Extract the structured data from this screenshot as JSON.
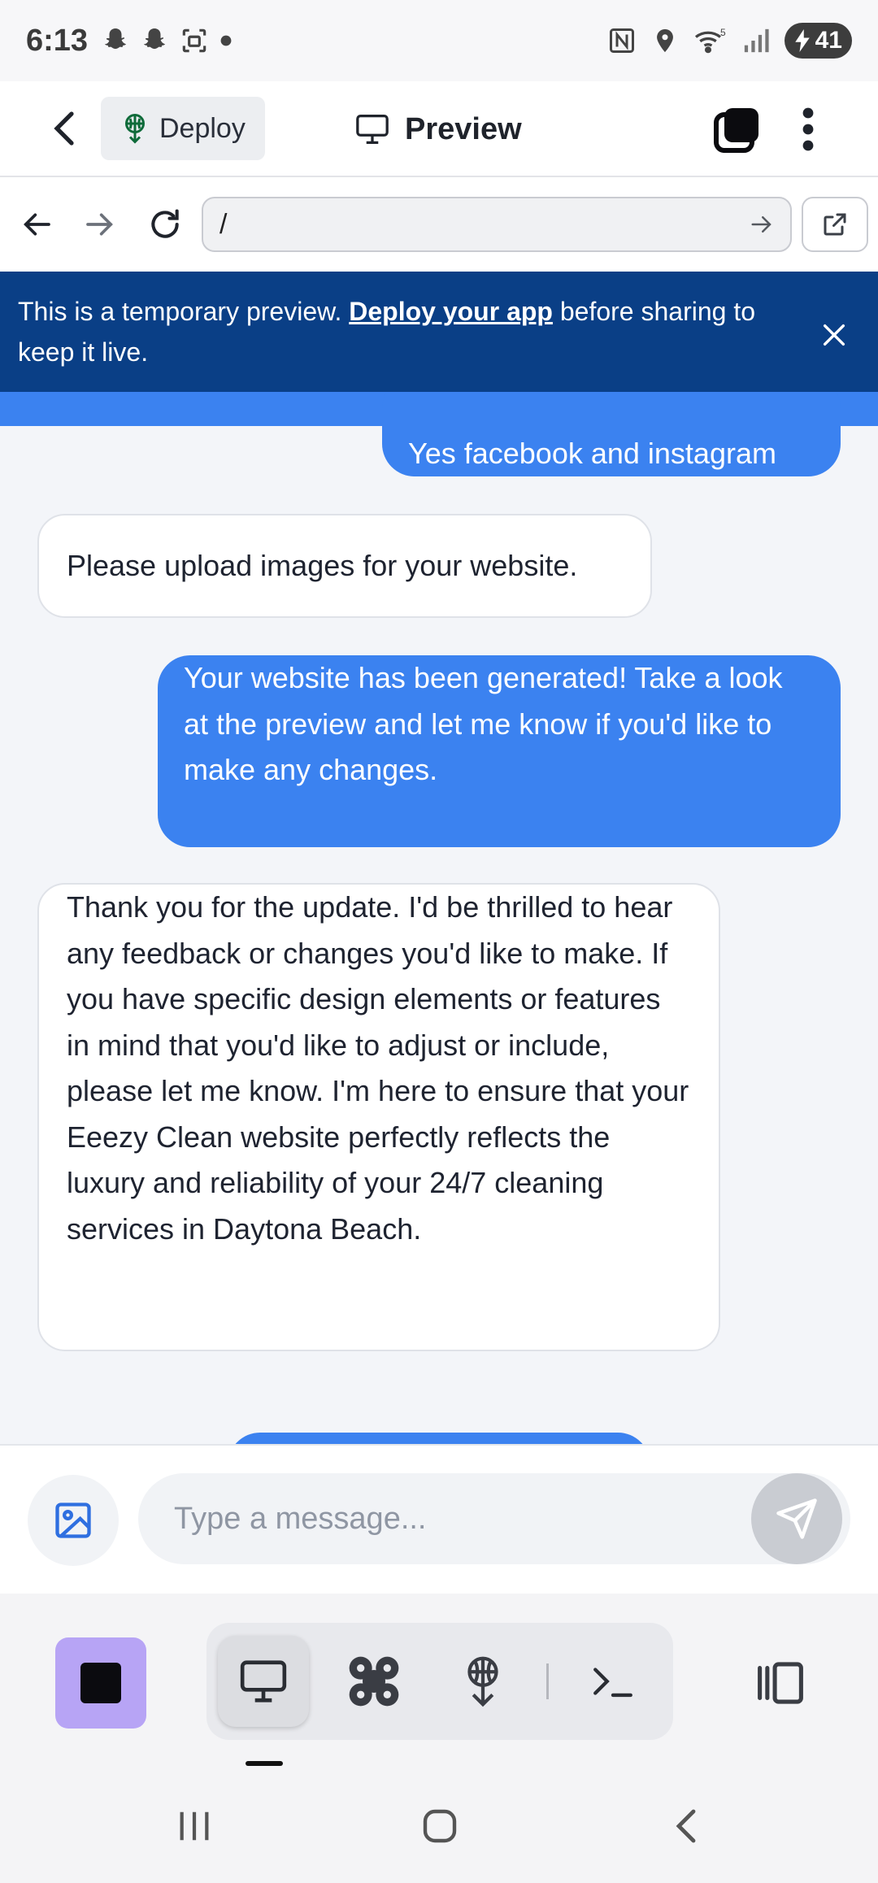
{
  "status_bar": {
    "time": "6:13",
    "battery_level": "41",
    "left_icons": [
      "snapchat-icon",
      "snapchat-icon",
      "screenshot-icon",
      "dot-icon"
    ],
    "right_icons": [
      "nfc-icon",
      "location-icon",
      "wifi-icon",
      "signal-icon",
      "battery-icon"
    ]
  },
  "header": {
    "deploy_label": "Deploy",
    "title": "Preview"
  },
  "url_bar": {
    "value": "/"
  },
  "banner": {
    "text_before": "This is a temporary preview.",
    "link_text": "Deploy your app",
    "text_after": "before sharing to keep it live."
  },
  "messages": [
    {
      "role": "user",
      "text": "Yes facebook and instagram",
      "partial": true
    },
    {
      "role": "bot",
      "text": "Please upload images for your website."
    },
    {
      "role": "user",
      "text": "Your website has been generated! Take a look at the preview and let me know if you'd like to make any changes."
    },
    {
      "role": "bot",
      "text": "Thank you for the update. I'd be thrilled to hear any feedback or changes you'd like to make. If you have specific design elements or features in mind that you'd like to adjust or include, please let me know. I'm here to ensure that your Eeezy Clean website perfectly reflects the luxury and reliability of your 24/7 cleaning services in Daytona Beach."
    }
  ],
  "composer": {
    "placeholder": "Type a message..."
  },
  "colors": {
    "user_bubble": "#3b82f0",
    "banner": "#0a3f86",
    "stop_button": "#b7a4f5"
  }
}
